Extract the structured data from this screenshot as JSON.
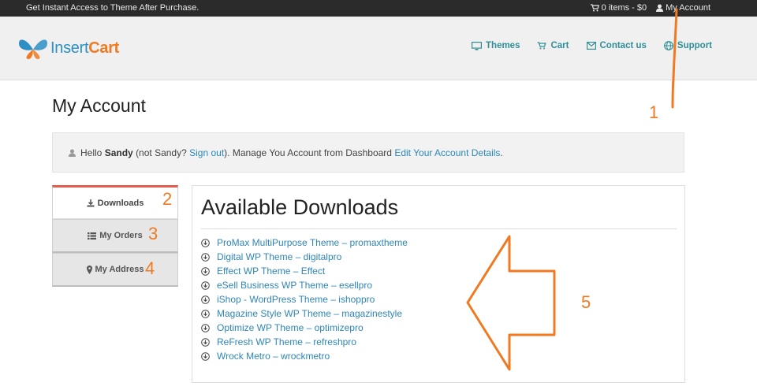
{
  "topbar": {
    "promo": "Get Instant Access to Theme After Purchase.",
    "cart": "0 items - $0",
    "account": "My Account"
  },
  "logo": {
    "part1": "Insert",
    "part2": "Cart"
  },
  "nav": [
    "Themes",
    "Cart",
    "Contact us",
    "Support"
  ],
  "page_title": "My Account",
  "hello": {
    "greeting": "Hello",
    "name": "Sandy",
    "not_prefix": "(not Sandy?",
    "sign_out": "Sign out",
    "middle": "). Manage You Account from Dashboard",
    "edit_link": "Edit Your Account Details",
    "end": "."
  },
  "tabs": [
    "Downloads",
    "My Orders",
    "My Address"
  ],
  "downloads": {
    "title": "Available Downloads",
    "items": [
      "ProMax MultiPurpose Theme – promaxtheme",
      "Digital WP Theme – digitalpro",
      "Effect WP Theme – Effect",
      "eSell Business WP Theme – esellpro",
      "iShop - WordPress Theme – ishoppro",
      "Magazine Style WP Theme – magazinestyle",
      "Optimize WP Theme – optimizepro",
      "ReFresh WP Theme – refreshpro",
      "Wrock Metro – wrockmetro"
    ]
  },
  "annotations": [
    "1",
    "2",
    "3",
    "4",
    "5"
  ],
  "colors": {
    "accent": "#f07a22",
    "link": "#2a88b8",
    "nav": "#2f8f98",
    "active_tab": "#e25c4d"
  }
}
